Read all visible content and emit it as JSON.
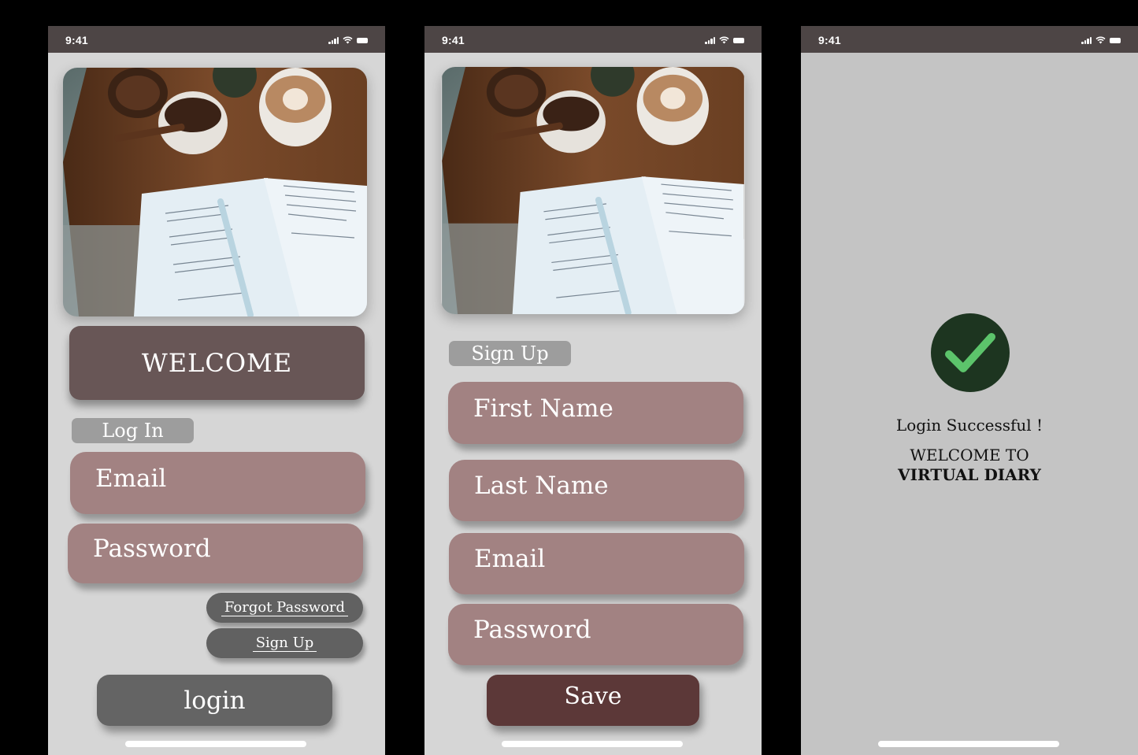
{
  "status_bar": {
    "time": "9:41"
  },
  "login_screen": {
    "welcome": "WELCOME",
    "section_label": "Log In",
    "email_placeholder": "Email",
    "password_placeholder": "Password",
    "forgot_password": "Forgot Password",
    "sign_up": "Sign Up",
    "login_button": "login"
  },
  "signup_screen": {
    "section_label": "Sign Up",
    "first_name_placeholder": "First Name",
    "last_name_placeholder": "Last Name",
    "email_placeholder": "Email",
    "password_placeholder": "Password",
    "save_button": "Save"
  },
  "success_screen": {
    "message": "Login Successful !",
    "welcome_line": "WELCOME TO",
    "app_name": "VIRTUAL DIARY"
  },
  "colors": {
    "status_bar": "#4d4545",
    "welcome_banner": "#685656",
    "input_field": "#a28282",
    "tag": "#9d9d9d",
    "pill_button": "#616161",
    "login_button": "#646464",
    "save_button": "#5c3838",
    "success_check_bg": "#1d3520",
    "success_check": "#5cc46b"
  },
  "icons": [
    "signal-icon",
    "wifi-icon",
    "battery-icon",
    "checkmark-icon"
  ]
}
